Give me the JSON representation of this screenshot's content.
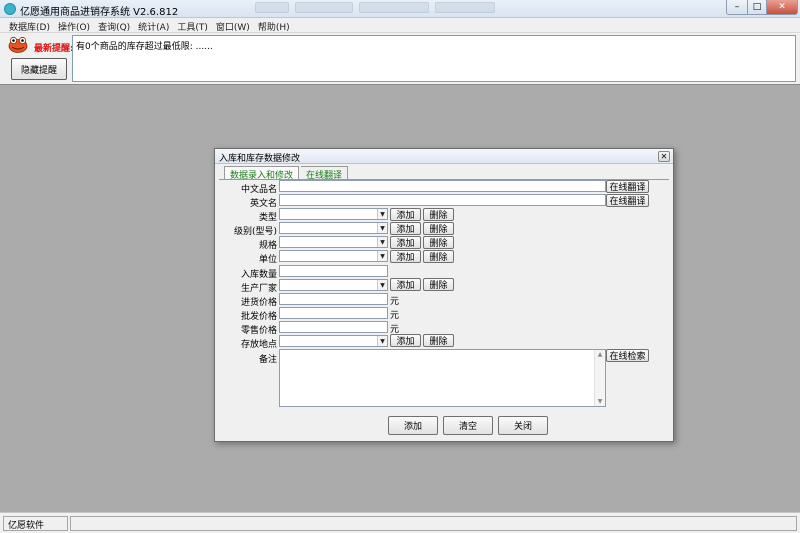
{
  "window": {
    "title": "亿愿通用商品进销存系统 V2.6.812",
    "controls": {
      "minimize": "–",
      "maximize": "□",
      "close": "✕"
    }
  },
  "menu": [
    "数据库(D)",
    "操作(O)",
    "查询(Q)",
    "统计(A)",
    "工具(T)",
    "窗口(W)",
    "帮助(H)"
  ],
  "alert": {
    "title": "最新提醒:",
    "hide_button": "隐藏提醒",
    "message": "有0个商品的库存超过最低限: ......",
    "icon": "frog-icon"
  },
  "status": {
    "company": "亿愿软件"
  },
  "dialog": {
    "title": "入库和库存数据修改",
    "close": "✕",
    "tabs": [
      "数据录入和修改",
      "在线翻译"
    ],
    "fields": {
      "cn_name": "中文品名",
      "en_name": "英文名",
      "type": "类型",
      "grade": "级别(型号)",
      "spec": "规格",
      "unit": "单位",
      "qty": "入库数量",
      "maker": "生产厂家",
      "cost_price": "进货价格",
      "wholesale_price": "批发价格",
      "retail_price": "零售价格",
      "location": "存放地点",
      "remark": "备注"
    },
    "currency_unit": "元",
    "buttons": {
      "translate": "在线翻译",
      "add": "添加",
      "delete": "删除",
      "search": "在线检索",
      "submit": "添加",
      "clear": "清空",
      "close": "关闭"
    }
  }
}
